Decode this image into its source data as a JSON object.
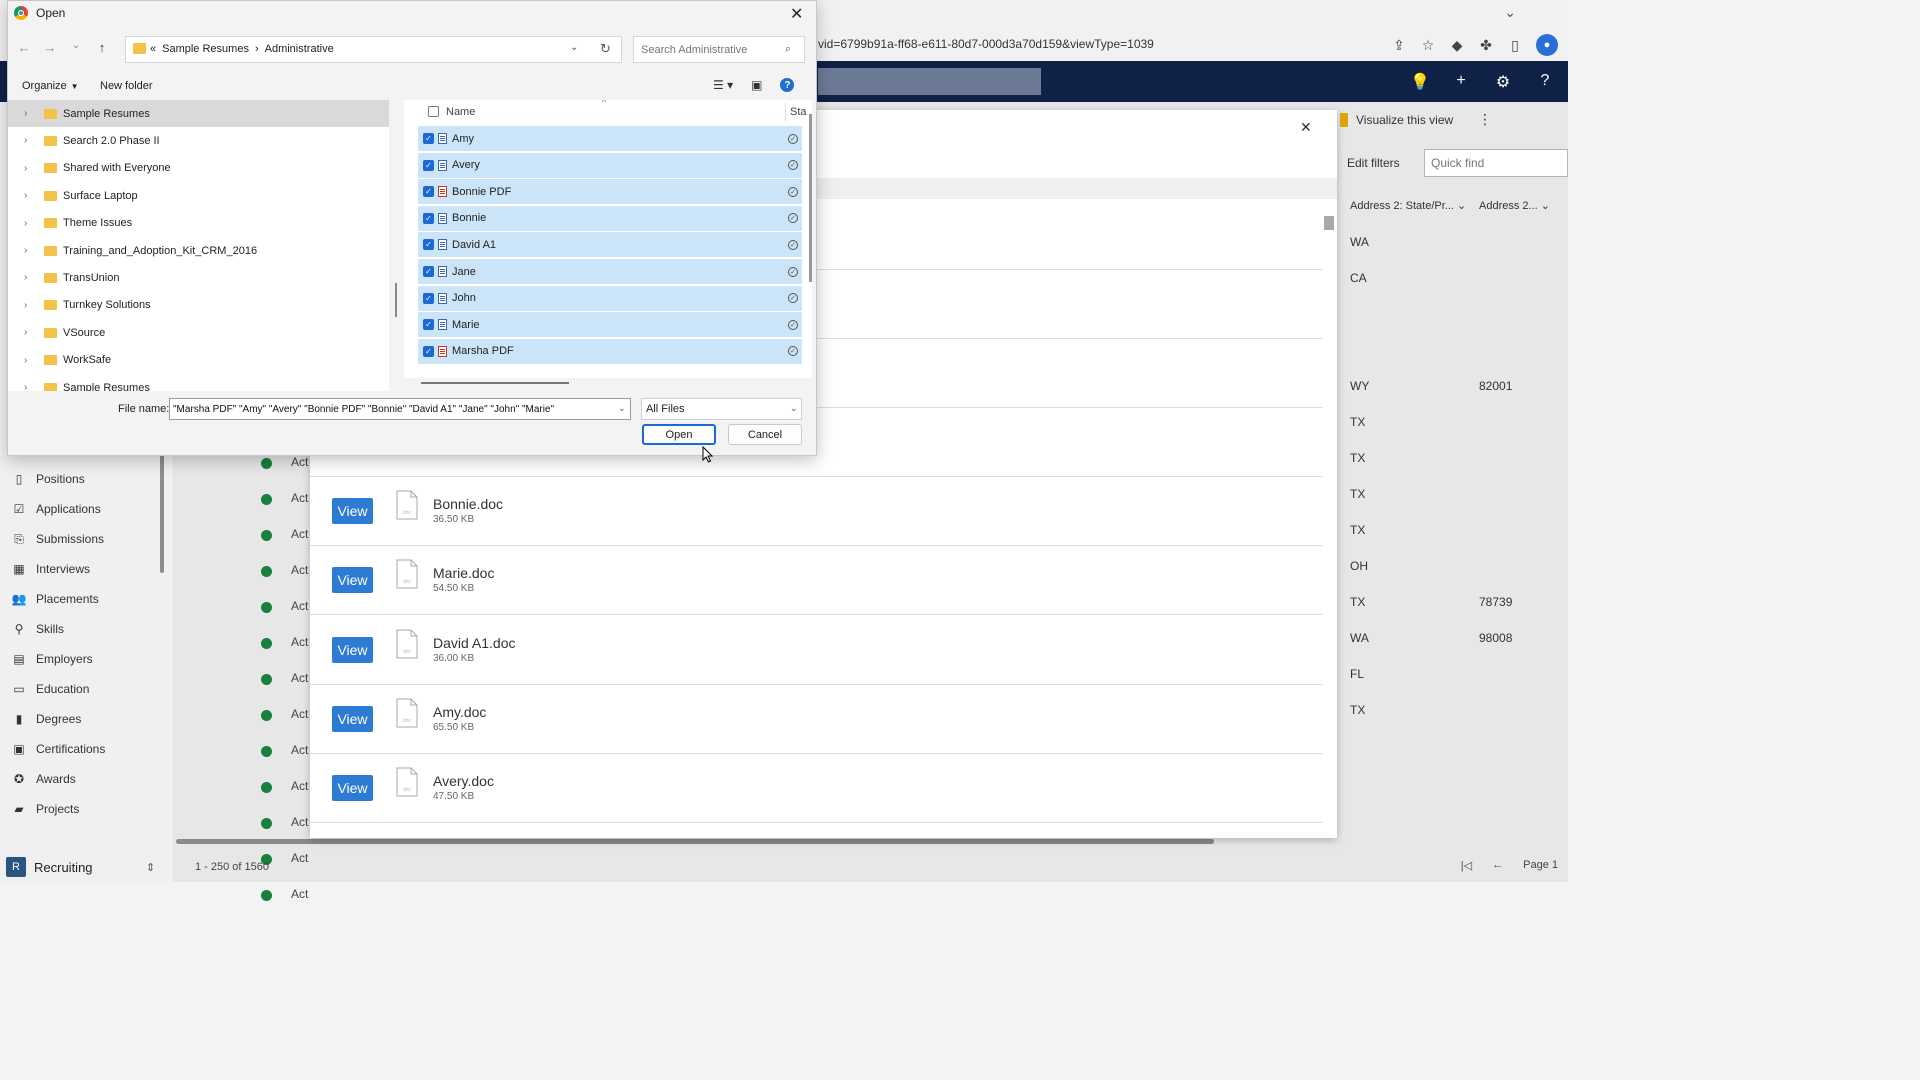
{
  "browser": {
    "url_fragment": "vid=6799b91a-ff68-e611-80d7-000d3a70d159&viewType=1039",
    "icons": [
      "share-icon",
      "star-icon",
      "extension-icon",
      "puzzle-icon",
      "sidebar-icon",
      "profile-icon"
    ]
  },
  "app_header": {
    "icons": [
      "lightbulb-icon",
      "plus-icon",
      "gear-icon",
      "help-icon"
    ]
  },
  "sidebar": {
    "items": [
      {
        "label": "Positions",
        "icon": "positions-icon"
      },
      {
        "label": "Applications",
        "icon": "applications-icon"
      },
      {
        "label": "Submissions",
        "icon": "submissions-icon"
      },
      {
        "label": "Interviews",
        "icon": "calendar-icon"
      },
      {
        "label": "Placements",
        "icon": "people-icon"
      },
      {
        "label": "Skills",
        "icon": "skills-icon"
      },
      {
        "label": "Employers",
        "icon": "building-icon"
      },
      {
        "label": "Education",
        "icon": "abc-icon"
      },
      {
        "label": "Degrees",
        "icon": "book-icon"
      },
      {
        "label": "Certifications",
        "icon": "certificate-icon"
      },
      {
        "label": "Awards",
        "icon": "award-icon"
      },
      {
        "label": "Projects",
        "icon": "briefcase-icon"
      }
    ],
    "area": {
      "badge": "R",
      "label": "Recruiting"
    }
  },
  "grid": {
    "status_text": "Act",
    "footer": "1 - 250 of 1560",
    "page_label": "Page 1"
  },
  "right_panel": {
    "visualize": "Visualize this view",
    "edit_filters": "Edit filters",
    "quick_find_placeholder": "Quick find",
    "columns": [
      "Address 2: State/Pr...",
      "Address 2..."
    ],
    "rows": [
      {
        "state": "WA",
        "zip": ""
      },
      {
        "state": "CA",
        "zip": ""
      },
      {
        "state": "WY",
        "zip": "82001"
      },
      {
        "state": "TX",
        "zip": ""
      },
      {
        "state": "TX",
        "zip": ""
      },
      {
        "state": "TX",
        "zip": ""
      },
      {
        "state": "TX",
        "zip": ""
      },
      {
        "state": "OH",
        "zip": ""
      },
      {
        "state": "TX",
        "zip": "78739"
      },
      {
        "state": "WA",
        "zip": "98008"
      },
      {
        "state": "FL",
        "zip": ""
      },
      {
        "state": "TX",
        "zip": ""
      }
    ]
  },
  "attachments": {
    "view_label": "View",
    "doc_icon_text": "doc",
    "files": [
      {
        "name": "Bonnie.doc",
        "size": "36.50 KB"
      },
      {
        "name": "Marie.doc",
        "size": "54.50 KB"
      },
      {
        "name": "David A1.doc",
        "size": "36.00 KB"
      },
      {
        "name": "Amy.doc",
        "size": "65.50 KB"
      },
      {
        "name": "Avery.doc",
        "size": "47.50 KB"
      }
    ]
  },
  "dialog": {
    "title": "Open",
    "breadcrumb": [
      "Sample Resumes",
      "Administrative"
    ],
    "breadcrumb_prefix": "«",
    "search_placeholder": "Search Administrative",
    "organize": "Organize",
    "new_folder": "New folder",
    "tree": [
      {
        "label": "Sample Resumes",
        "selected": true
      },
      {
        "label": "Search 2.0 Phase II"
      },
      {
        "label": "Shared with Everyone"
      },
      {
        "label": "Surface Laptop"
      },
      {
        "label": "Theme Issues"
      },
      {
        "label": "Training_and_Adoption_Kit_CRM_2016"
      },
      {
        "label": "TransUnion"
      },
      {
        "label": "Turnkey Solutions"
      },
      {
        "label": "VSource"
      },
      {
        "label": "WorkSafe"
      },
      {
        "label": "Sample Resumes"
      }
    ],
    "list_header": {
      "name": "Name",
      "status": "Sta"
    },
    "files": [
      {
        "name": "Amy",
        "type": "doc"
      },
      {
        "name": "Avery",
        "type": "doc"
      },
      {
        "name": "Bonnie PDF",
        "type": "pdf"
      },
      {
        "name": "Bonnie",
        "type": "doc"
      },
      {
        "name": "David A1",
        "type": "doc"
      },
      {
        "name": "Jane",
        "type": "doc"
      },
      {
        "name": "John",
        "type": "doc"
      },
      {
        "name": "Marie",
        "type": "doc"
      },
      {
        "name": "Marsha PDF",
        "type": "pdf"
      }
    ],
    "file_name_label": "File name:",
    "file_name_value": "\"Marsha PDF\" \"Amy\" \"Avery\" \"Bonnie PDF\" \"Bonnie\" \"David A1\" \"Jane\" \"John\" \"Marie\"",
    "file_type": "All Files",
    "open_label": "Open",
    "cancel_label": "Cancel"
  }
}
